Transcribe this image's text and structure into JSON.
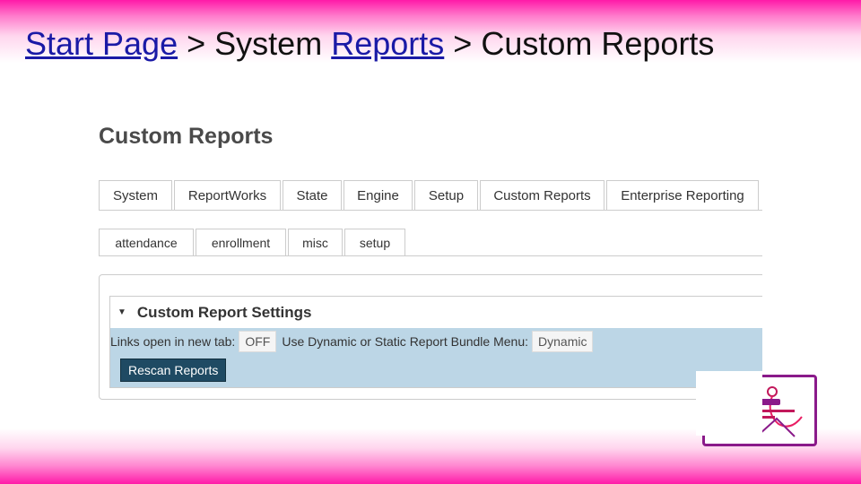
{
  "breadcrumb": {
    "items": [
      {
        "label": "Start Page",
        "link": true
      },
      {
        "label": "System",
        "link": false
      },
      {
        "label": "Reports",
        "link": true
      },
      {
        "label": "Custom Reports",
        "link": false
      }
    ],
    "separator": ">"
  },
  "page": {
    "heading": "Custom Reports"
  },
  "top_tabs": [
    "System",
    "ReportWorks",
    "State",
    "Engine",
    "Setup",
    "Custom Reports",
    "Enterprise Reporting"
  ],
  "sub_tabs": [
    "attendance",
    "enrollment",
    "misc",
    "setup"
  ],
  "settings": {
    "title": "Custom Report Settings",
    "links_label": "Links open in new tab:",
    "links_value": "OFF",
    "bundle_label": "Use Dynamic or Static Report Bundle Menu:",
    "bundle_value": "Dynamic",
    "rescan_button": "Rescan Reports"
  },
  "colors": {
    "accent_pink": "#ff1aa8",
    "link": "#1a1aa6",
    "settings_bg": "#bcd6e6",
    "button_bg": "#1f4a63",
    "logo_border": "#8a1a8a"
  }
}
